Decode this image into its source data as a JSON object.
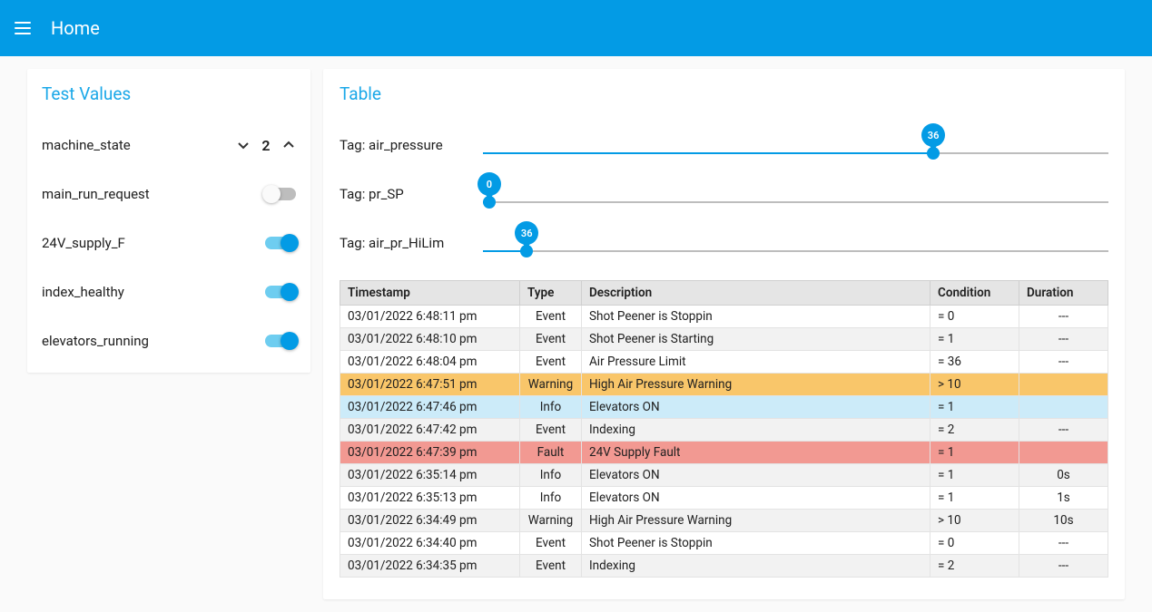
{
  "app": {
    "title": "Home"
  },
  "sidebar": {
    "title": "Test Values",
    "machine_state": {
      "label": "machine_state",
      "value": "2"
    },
    "toggles": [
      {
        "label": "main_run_request",
        "on": false
      },
      {
        "label": "24V_supply_F",
        "on": true
      },
      {
        "label": "index_healthy",
        "on": true
      },
      {
        "label": "elevators_running",
        "on": true
      }
    ]
  },
  "main": {
    "title": "Table",
    "sliders": [
      {
        "label": "Tag: air_pressure",
        "value": 36,
        "min": 0,
        "max": 50,
        "pct": 72
      },
      {
        "label": "Tag: pr_SP",
        "value": 0,
        "min": 0,
        "max": 50,
        "pct": 1
      },
      {
        "label": "Tag: air_pr_HiLim",
        "value": 36,
        "min": 0,
        "max": 500,
        "pct": 7
      }
    ],
    "columns": {
      "timestamp": "Timestamp",
      "type": "Type",
      "description": "Description",
      "condition": "Condition",
      "duration": "Duration"
    },
    "rows": [
      {
        "ts": "03/01/2022 6:48:11 pm",
        "type": "Event",
        "desc": "Shot Peener is Stoppin",
        "cond": "= 0",
        "dur": "---",
        "rowClass": ""
      },
      {
        "ts": "03/01/2022 6:48:10 pm",
        "type": "Event",
        "desc": "Shot Peener is Starting",
        "cond": "= 1",
        "dur": "---",
        "rowClass": "stripe"
      },
      {
        "ts": "03/01/2022 6:48:04 pm",
        "type": "Event",
        "desc": "Air Pressure Limit",
        "cond": "= 36",
        "dur": "---",
        "rowClass": ""
      },
      {
        "ts": "03/01/2022 6:47:51 pm",
        "type": "Warning",
        "desc": "High Air Pressure Warning",
        "cond": "> 10",
        "dur": "",
        "rowClass": "warn"
      },
      {
        "ts": "03/01/2022 6:47:46 pm",
        "type": "Info",
        "desc": "Elevators ON",
        "cond": "= 1",
        "dur": "",
        "rowClass": "info"
      },
      {
        "ts": "03/01/2022 6:47:42 pm",
        "type": "Event",
        "desc": "Indexing",
        "cond": "= 2",
        "dur": "---",
        "rowClass": "stripe"
      },
      {
        "ts": "03/01/2022 6:47:39 pm",
        "type": "Fault",
        "desc": "24V Supply Fault",
        "cond": "= 1",
        "dur": "",
        "rowClass": "fault"
      },
      {
        "ts": "03/01/2022 6:35:14 pm",
        "type": "Info",
        "desc": "Elevators ON",
        "cond": "= 1",
        "dur": "0s",
        "rowClass": "stripe"
      },
      {
        "ts": "03/01/2022 6:35:13 pm",
        "type": "Info",
        "desc": "Elevators ON",
        "cond": "= 1",
        "dur": "1s",
        "rowClass": ""
      },
      {
        "ts": "03/01/2022 6:34:49 pm",
        "type": "Warning",
        "desc": "High Air Pressure Warning",
        "cond": "> 10",
        "dur": "10s",
        "rowClass": "stripe"
      },
      {
        "ts": "03/01/2022 6:34:40 pm",
        "type": "Event",
        "desc": "Shot Peener is Stoppin",
        "cond": "= 0",
        "dur": "---",
        "rowClass": ""
      },
      {
        "ts": "03/01/2022 6:34:35 pm",
        "type": "Event",
        "desc": "Indexing",
        "cond": "= 2",
        "dur": "---",
        "rowClass": "stripe"
      }
    ]
  }
}
